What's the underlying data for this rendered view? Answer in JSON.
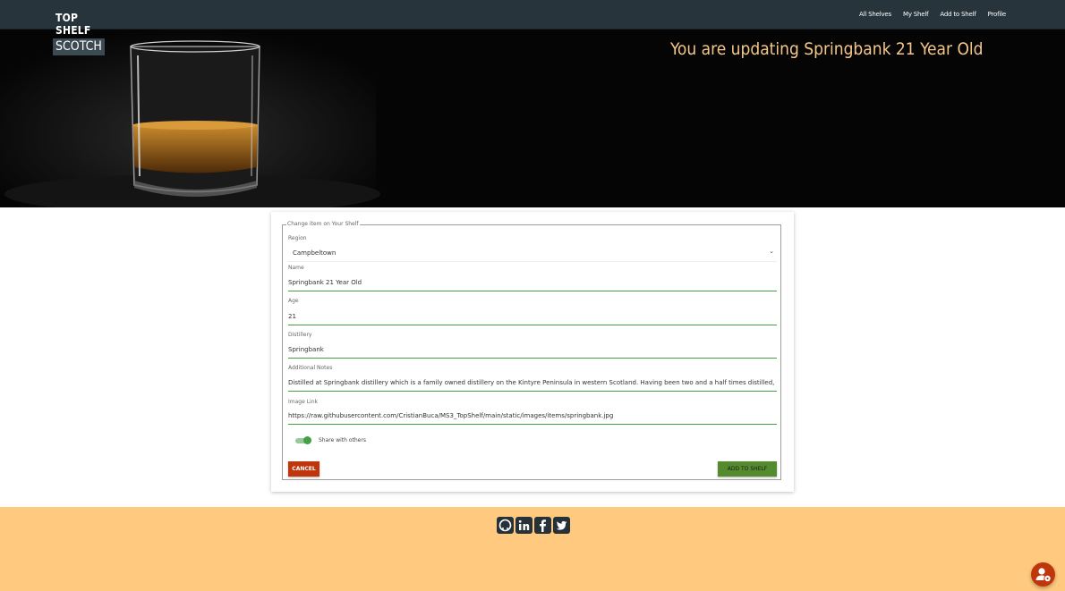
{
  "brand": {
    "line1": "TOP SHELF",
    "line2": "SCOTCH"
  },
  "nav": {
    "items": [
      "All Shelves",
      "My Shelf",
      "Add to Shelf",
      "Profile"
    ]
  },
  "hero": {
    "title": "You are updating Springbank 21 Year Old"
  },
  "form": {
    "legend": "Change item on Your Shelf",
    "region": {
      "label": "Region",
      "value": "Campbeltown"
    },
    "name": {
      "label": "Name",
      "value": "Springbank 21 Year Old"
    },
    "age": {
      "label": "Age",
      "value": "21"
    },
    "distillery": {
      "label": "Distillery",
      "value": "Springbank"
    },
    "notes": {
      "label": "Additional Notes",
      "value": "Distilled at Springbank distillery which is a family owned distillery on the Kintyre Peninsula in western Scotland. Having been two and a half times distilled, this e"
    },
    "image": {
      "label": "Image Link",
      "value": "https://raw.githubusercontent.com/CristianBuca/MS3_TopShelf/main/static/images/items/springbank.jpg"
    },
    "share_label": "Share with others",
    "share_on": true,
    "cancel_label": "CANCEL",
    "submit_label": "ADD TO SHELF"
  },
  "colors": {
    "nav": "#27343b",
    "hero_title": "#f6c78a",
    "footer": "#ffca7f",
    "cancel": "#bf360c",
    "submit": "#558b2f",
    "accent": "#43a047"
  },
  "footer": {
    "icons": [
      "github-icon",
      "linkedin-icon",
      "facebook-icon",
      "twitter-icon"
    ]
  },
  "fab_icon": "user-settings-icon"
}
